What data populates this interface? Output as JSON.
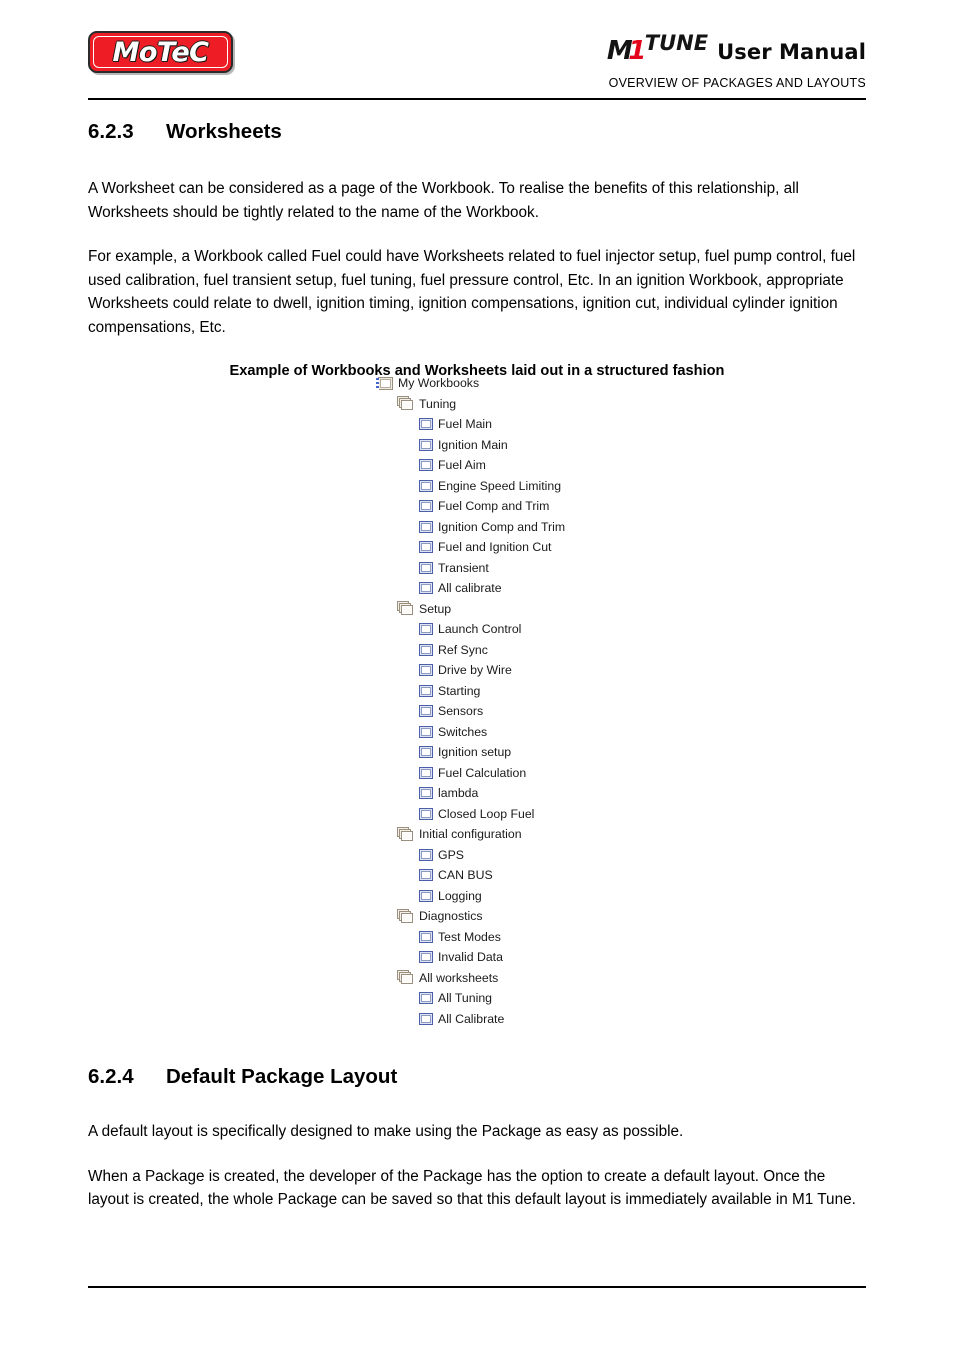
{
  "header": {
    "logo_text": "MoTeC",
    "product_m": "M",
    "product_one": "1",
    "product_tune": "TUNE",
    "manual_label": "User Manual",
    "subtitle": "OVERVIEW OF PACKAGES AND LAYOUTS",
    "brand_red": "#ee1c24",
    "accent_red": "#e3051b"
  },
  "sections": {
    "worksheets": {
      "number": "6.2.3",
      "title": "Worksheets",
      "paragraph_1": "A Worksheet can be considered as a page of the Workbook. To realise the benefits of this relationship, all Worksheets should be tightly related to the name of the Workbook.",
      "paragraph_2": "For example, a Workbook called Fuel could have Worksheets related to fuel injector setup, fuel pump control, fuel used calibration, fuel transient setup, fuel tuning, fuel pressure control, Etc. In an ignition Workbook, appropriate Worksheets could relate to dwell, ignition timing, ignition compensations, ignition cut, individual cylinder ignition compensations, Etc.",
      "figure_caption": "Example of Workbooks and Worksheets laid out in a structured fashion"
    },
    "default_package_layout": {
      "number": "6.2.4",
      "title": "Default Package Layout",
      "paragraph_1": "A default layout is specifically designed to make using the Package as easy as possible.",
      "paragraph_2": "When a Package is created, the developer of the Package has the option to create a default layout. Once the layout is created, the whole Package can be saved so that this default layout is immediately available in M1 Tune."
    }
  },
  "tree": {
    "rows": [
      {
        "label": "My Workbooks",
        "level": 0,
        "icon": "workbooks-root-icon"
      },
      {
        "label": "Tuning",
        "level": 1,
        "icon": "workbook-group-icon"
      },
      {
        "label": "Fuel Main",
        "level": 2,
        "icon": "worksheet-icon"
      },
      {
        "label": "Ignition Main",
        "level": 2,
        "icon": "worksheet-icon"
      },
      {
        "label": "Fuel Aim",
        "level": 2,
        "icon": "worksheet-icon"
      },
      {
        "label": "Engine Speed Limiting",
        "level": 2,
        "icon": "worksheet-icon"
      },
      {
        "label": "Fuel Comp and Trim",
        "level": 2,
        "icon": "worksheet-icon"
      },
      {
        "label": "Ignition Comp and Trim",
        "level": 2,
        "icon": "worksheet-icon"
      },
      {
        "label": "Fuel and Ignition Cut",
        "level": 2,
        "icon": "worksheet-icon"
      },
      {
        "label": "Transient",
        "level": 2,
        "icon": "worksheet-icon"
      },
      {
        "label": "All calibrate",
        "level": 2,
        "icon": "worksheet-icon"
      },
      {
        "label": "Setup",
        "level": 1,
        "icon": "workbook-group-icon"
      },
      {
        "label": "Launch Control",
        "level": 2,
        "icon": "worksheet-icon"
      },
      {
        "label": "Ref Sync",
        "level": 2,
        "icon": "worksheet-icon"
      },
      {
        "label": "Drive by Wire",
        "level": 2,
        "icon": "worksheet-icon"
      },
      {
        "label": "Starting",
        "level": 2,
        "icon": "worksheet-icon"
      },
      {
        "label": "Sensors",
        "level": 2,
        "icon": "worksheet-icon"
      },
      {
        "label": "Switches",
        "level": 2,
        "icon": "worksheet-icon"
      },
      {
        "label": "Ignition setup",
        "level": 2,
        "icon": "worksheet-icon"
      },
      {
        "label": "Fuel Calculation",
        "level": 2,
        "icon": "worksheet-icon"
      },
      {
        "label": "lambda",
        "level": 2,
        "icon": "worksheet-icon"
      },
      {
        "label": "Closed Loop Fuel",
        "level": 2,
        "icon": "worksheet-icon"
      },
      {
        "label": "Initial configuration",
        "level": 1,
        "icon": "workbook-group-icon"
      },
      {
        "label": "GPS",
        "level": 2,
        "icon": "worksheet-icon"
      },
      {
        "label": "CAN BUS",
        "level": 2,
        "icon": "worksheet-icon"
      },
      {
        "label": "Logging",
        "level": 2,
        "icon": "worksheet-icon"
      },
      {
        "label": "Diagnostics",
        "level": 1,
        "icon": "workbook-group-icon"
      },
      {
        "label": "Test Modes",
        "level": 2,
        "icon": "worksheet-icon"
      },
      {
        "label": "Invalid Data",
        "level": 2,
        "icon": "worksheet-icon"
      },
      {
        "label": "All worksheets",
        "level": 1,
        "icon": "workbook-group-icon"
      },
      {
        "label": "All Tuning",
        "level": 2,
        "icon": "worksheet-icon"
      },
      {
        "label": "All Calibrate",
        "level": 2,
        "icon": "worksheet-icon"
      }
    ]
  }
}
